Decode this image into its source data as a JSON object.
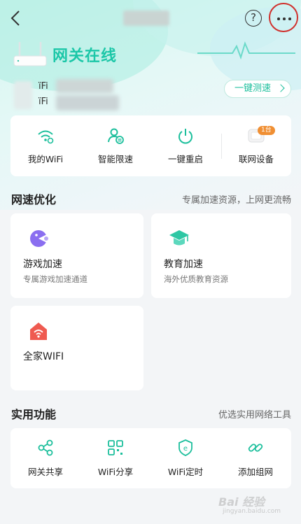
{
  "header": {
    "status_title": "网关在线",
    "wifi_line_1": "ïFi",
    "wifi_line_2": "ïFi",
    "speedtest_label": "一键测速",
    "help_label": "?"
  },
  "quick_actions": [
    {
      "label": "我的WiFi",
      "icon": "wifi-settings-icon"
    },
    {
      "label": "智能限速",
      "icon": "user-speed-limit-icon"
    },
    {
      "label": "一键重启",
      "icon": "power-icon"
    },
    {
      "label": "联网设备",
      "icon": "device-icon",
      "badge": "1台"
    }
  ],
  "speed_section": {
    "title": "网速优化",
    "subtitle": "专属加速资源，上网更流畅",
    "cards": [
      {
        "name": "游戏加速",
        "desc": "专属游戏加速通道",
        "icon": "game-icon",
        "color": "#8a6ef0"
      },
      {
        "name": "教育加速",
        "desc": "海外优质教育资源",
        "icon": "education-icon",
        "color": "#2ec7a4"
      },
      {
        "name": "全家WIFI",
        "desc": "",
        "icon": "home-wifi-icon",
        "color": "#ef5a50"
      }
    ]
  },
  "tools_section": {
    "title": "实用功能",
    "subtitle": "优选实用网络工具",
    "items": [
      {
        "label": "网关共享",
        "icon": "share-icon"
      },
      {
        "label": "WiFi分享",
        "icon": "qrcode-icon"
      },
      {
        "label": "WiFi定时",
        "icon": "timer-icon"
      },
      {
        "label": "添加组网",
        "icon": "link-icon"
      }
    ]
  },
  "watermark": {
    "text": "Bai 经验",
    "site": "jingyan.baidu.com"
  },
  "colors": {
    "accent": "#1cc7a8",
    "highlight_ring": "#d0312d",
    "badge": "#f08f33"
  }
}
